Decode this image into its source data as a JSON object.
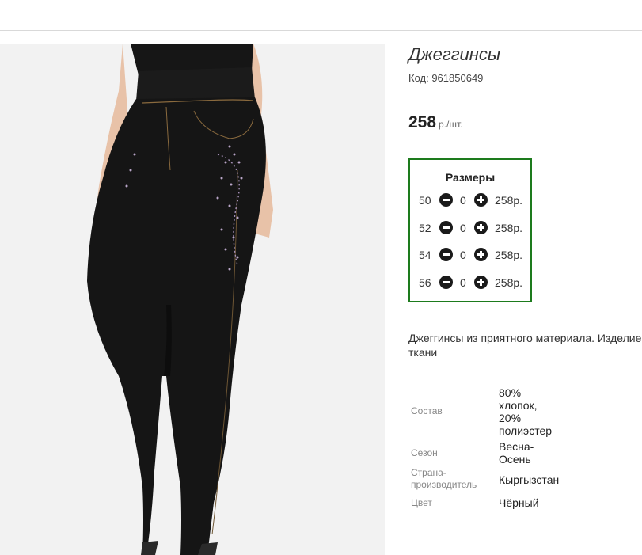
{
  "product": {
    "title": "Джеггинсы",
    "code_label": "Код: ",
    "code": "961850649",
    "price": "258",
    "price_unit": "р./шт."
  },
  "sizes": {
    "title": "Размеры",
    "rows": [
      {
        "size": "50",
        "qty": "0",
        "price": "258р."
      },
      {
        "size": "52",
        "qty": "0",
        "price": "258р."
      },
      {
        "size": "54",
        "qty": "0",
        "price": "258р."
      },
      {
        "size": "56",
        "qty": "0",
        "price": "258р."
      }
    ]
  },
  "description": {
    "line1": "Джеггинсы из приятного материала. Изделие",
    "line2": "ткани"
  },
  "specs": [
    {
      "label": "Состав",
      "value_lines": [
        "80%",
        "хлопок,",
        "20%",
        "полиэстер"
      ]
    },
    {
      "label": "Сезон",
      "value_lines": [
        "Весна-",
        "Осень"
      ]
    },
    {
      "label_lines": [
        "Страна-",
        "производитель"
      ],
      "value_lines": [
        "Кыргызстан"
      ]
    },
    {
      "label": "Цвет",
      "value_lines": [
        "Чёрный"
      ]
    }
  ],
  "colors": {
    "sizes_border": "#1d7b1d",
    "divider": "#d9d9d9"
  }
}
